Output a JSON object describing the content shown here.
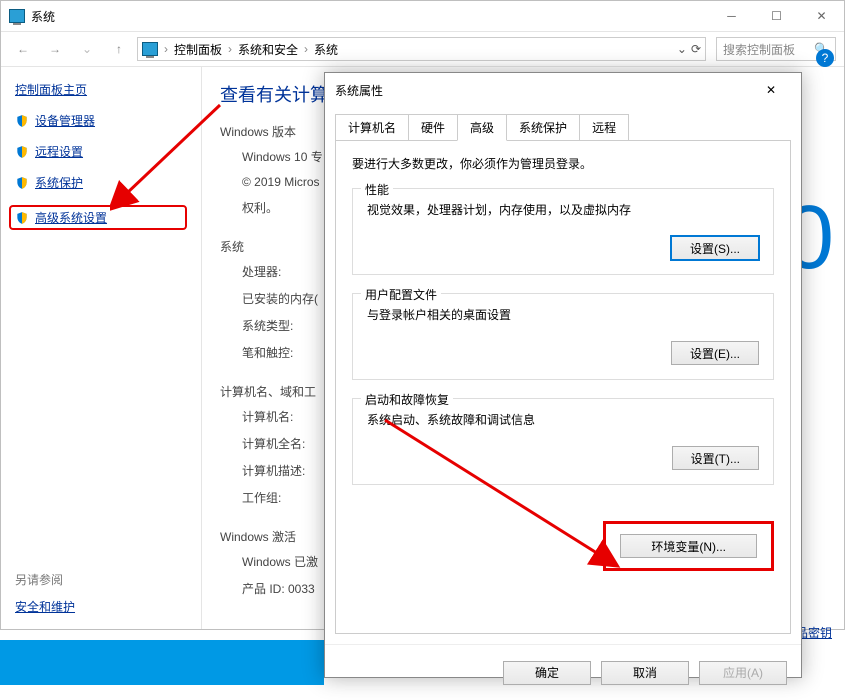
{
  "window": {
    "title": "系统",
    "breadcrumb": {
      "root": "控制面板",
      "l1": "系统和安全",
      "l2": "系统"
    },
    "search_placeholder": "搜索控制面板",
    "help": "?"
  },
  "sidebar": {
    "home": "控制面板主页",
    "items": [
      {
        "label": "设备管理器"
      },
      {
        "label": "远程设置"
      },
      {
        "label": "系统保护"
      },
      {
        "label": "高级系统设置"
      }
    ],
    "seealso": "另请参阅",
    "seealso_link": "安全和维护"
  },
  "main": {
    "heading": "查看有关计算",
    "g1_title": "Windows 版本",
    "g1_line1": "Windows 10 专",
    "g1_line2": "© 2019 Micros",
    "g1_line3": "权利。",
    "g2_title": "系统",
    "g2_l1": "处理器:",
    "g2_l2": "已安装的内存(",
    "g2_l3": "系统类型:",
    "g2_l4": "笔和触控:",
    "g3_title": "计算机名、域和工",
    "g3_l1": "计算机名:",
    "g3_l2": "计算机全名:",
    "g3_l3": "计算机描述:",
    "g3_l4": "工作组:",
    "g4_title": "Windows 激活",
    "g4_l1": "Windows 已激",
    "g4_l2": "产品 ID: 0033",
    "big": "0",
    "keylink": "品密钥"
  },
  "dialog": {
    "title": "系统属性",
    "tabs": {
      "t1": "计算机名",
      "t2": "硬件",
      "t3": "高级",
      "t4": "系统保护",
      "t5": "远程"
    },
    "notice": "要进行大多数更改，你必须作为管理员登录。",
    "perf": {
      "legend": "性能",
      "desc": "视觉效果，处理器计划，内存使用，以及虚拟内存",
      "btn": "设置(S)..."
    },
    "profile": {
      "legend": "用户配置文件",
      "desc": "与登录帐户相关的桌面设置",
      "btn": "设置(E)..."
    },
    "startup": {
      "legend": "启动和故障恢复",
      "desc": "系统启动、系统故障和调试信息",
      "btn": "设置(T)..."
    },
    "env_btn": "环境变量(N)...",
    "ok": "确定",
    "cancel": "取消",
    "apply": "应用(A)"
  }
}
